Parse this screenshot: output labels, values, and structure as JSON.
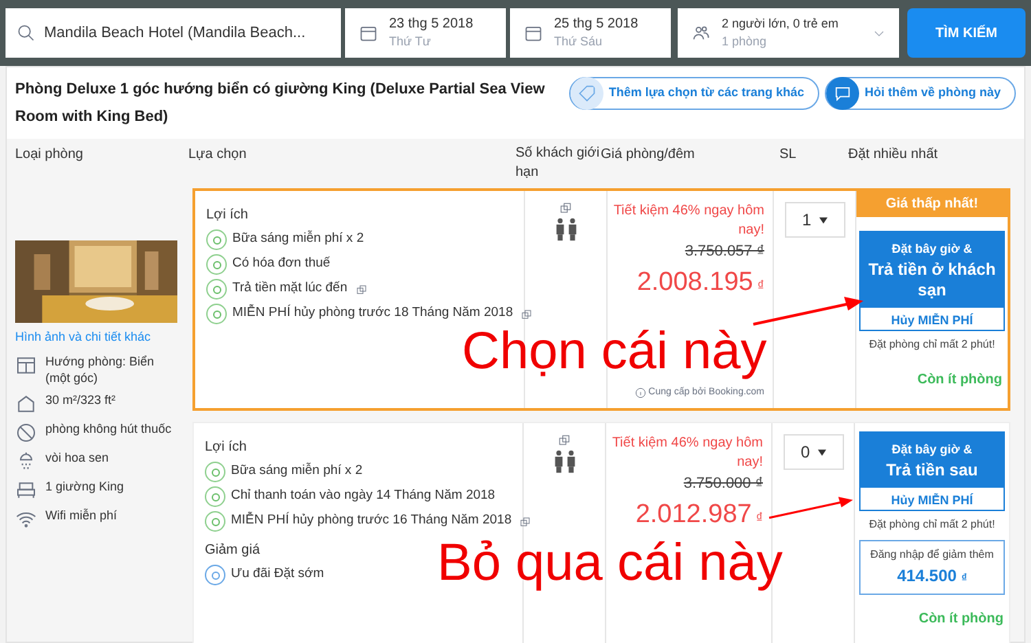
{
  "search": {
    "destination": "Mandila Beach Hotel (Mandila Beach...",
    "checkin": {
      "date": "23 thg 5 2018",
      "day": "Thứ Tư"
    },
    "checkout": {
      "date": "25 thg 5 2018",
      "day": "Thứ Sáu"
    },
    "guests": {
      "line1": "2 người lớn, 0 trẻ em",
      "line2": "1 phòng"
    },
    "button": "TÌM KIẾM"
  },
  "room": {
    "title": "Phòng Deluxe 1 góc hướng biển có giường King (Deluxe Partial Sea View Room with King Bed)",
    "actions": [
      {
        "kind": "tag",
        "label": "Thêm lựa chọn từ các trang khác"
      },
      {
        "kind": "chat",
        "label": "Hỏi thêm về phòng này"
      }
    ],
    "columns": [
      "Loại phòng",
      "Lựa chọn",
      "Số khách giới hạn",
      "Giá phòng/đêm",
      "SL",
      "Đặt nhiều nhất"
    ],
    "details_link": "Hình ảnh và chi tiết khác",
    "features": [
      {
        "kind": "window",
        "lines": [
          "Hướng phòng: Biển (một góc)"
        ]
      },
      {
        "kind": "area",
        "lines": [
          "30 m²/323 ft²"
        ]
      },
      {
        "kind": "nosmoking",
        "lines": [
          "phòng không hút thuốc"
        ]
      },
      {
        "kind": "shower",
        "lines": [
          "vòi hoa sen"
        ]
      },
      {
        "kind": "bed",
        "lines": [
          "1 giường King"
        ]
      },
      {
        "kind": "wifi",
        "lines": [
          "Wifi miễn phí"
        ]
      }
    ],
    "options": [
      {
        "badge": "Giá thấp nhất!",
        "sections": [
          {
            "kind": "benefit",
            "heading": "Lợi ích",
            "items": [
              {
                "text": "Bữa sáng miễn phí x 2",
                "external": false
              },
              {
                "text": "Có hóa đơn thuế",
                "external": false
              },
              {
                "text": "Trả tiền mặt lúc đến",
                "external": true
              },
              {
                "text": "MIỄN PHÍ hủy phòng trước 18 Tháng Năm 2018",
                "external": true
              }
            ]
          }
        ],
        "savings": "Tiết kiệm 46% ngay hôm nay!",
        "old_price": "3.750.057 ₫",
        "price": "2.008.195",
        "currency": "₫",
        "provider": "Cung cấp bởi Booking.com",
        "qty": "1",
        "book_top": "Đặt bây giờ &",
        "book_main": "Trả tiền ở khách sạn",
        "cancel": "Hủy MIỄN PHÍ",
        "note": "Đặt phòng chỉ mất 2 phút!",
        "availability": "Còn ít phòng"
      },
      {
        "sections": [
          {
            "kind": "benefit",
            "heading": "Lợi ích",
            "items": [
              {
                "text": "Bữa sáng miễn phí x 2",
                "external": false
              },
              {
                "text": "Chỉ thanh toán vào ngày 14 Tháng Năm 2018",
                "external": false
              },
              {
                "text": "MIỄN PHÍ hủy phòng trước 16 Tháng Năm 2018",
                "external": true
              }
            ]
          },
          {
            "kind": "discount",
            "heading": "Giảm giá",
            "items": [
              {
                "text": "Ưu đãi Đặt sớm",
                "external": false
              }
            ]
          }
        ],
        "savings": "Tiết kiệm 46% ngay hôm nay!",
        "old_price": "3.750.000 ₫",
        "price": "2.012.987",
        "currency": "₫",
        "qty": "0",
        "book_top": "Đặt bây giờ &",
        "book_main": "Trả tiền sau",
        "cancel": "Hủy MIỄN PHÍ",
        "note": "Đặt phòng chỉ mất 2 phút!",
        "login": {
          "text": "Đăng nhập để giảm thêm",
          "amount": "414.500",
          "currency": "₫"
        },
        "availability": "Còn ít phòng"
      }
    ]
  },
  "annotations": [
    "Chọn cái này",
    "Bỏ qua cái này"
  ]
}
